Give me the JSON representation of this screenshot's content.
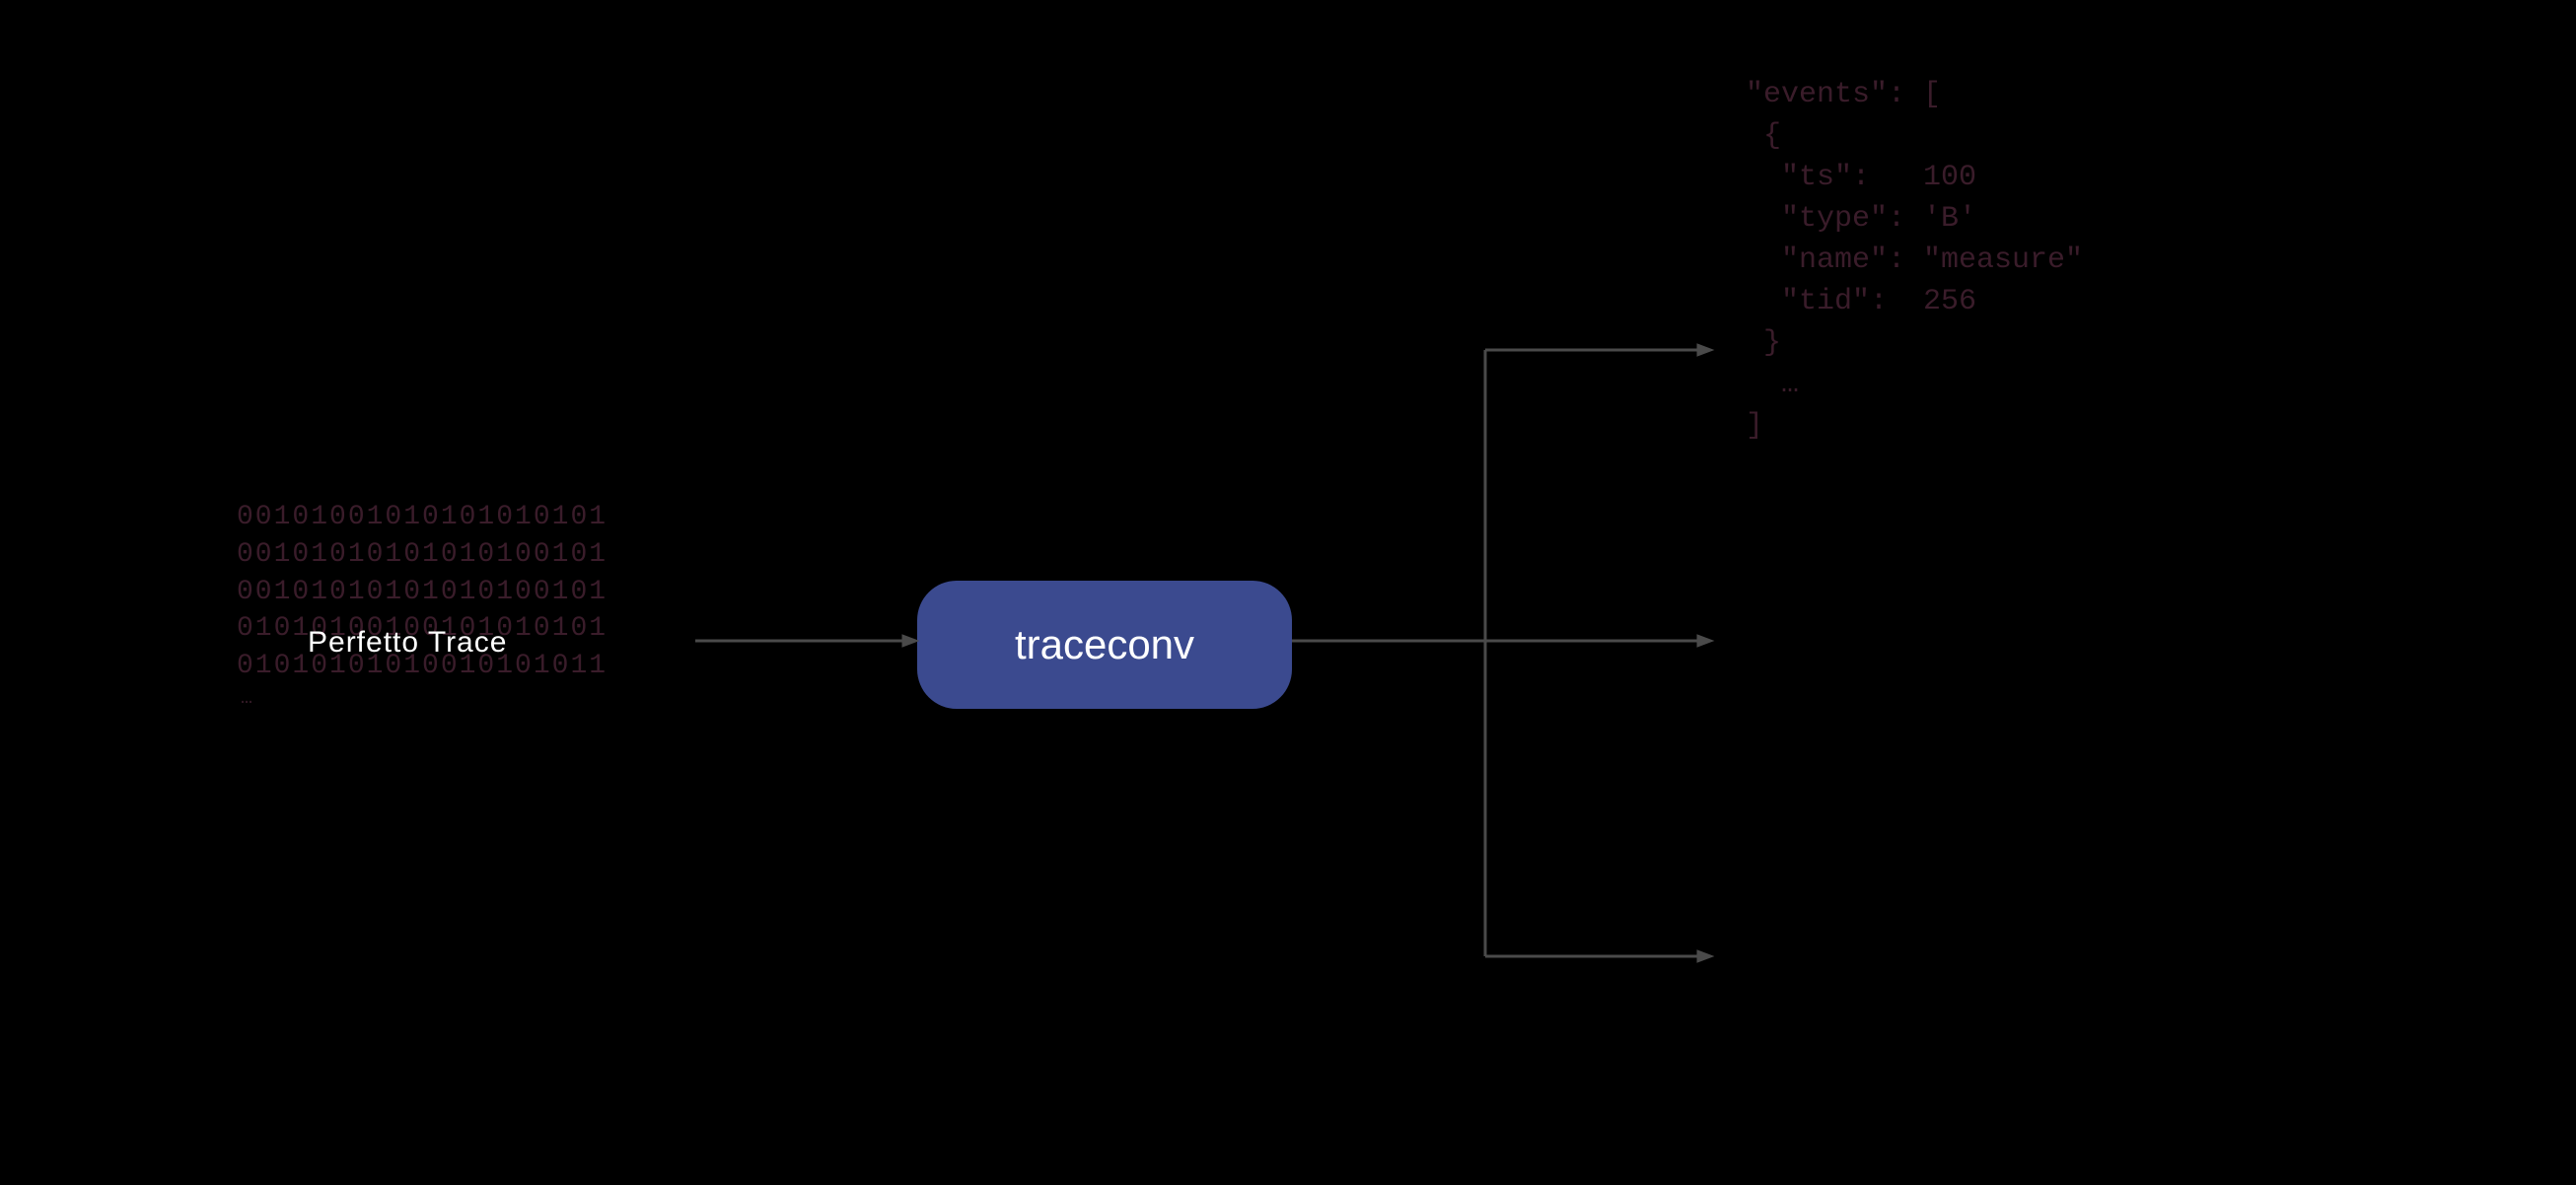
{
  "input": {
    "binary_lines": [
      "00101001010101010101",
      "00101010101010100101",
      "00101010101010100101",
      "01010100100101010101",
      "01010101010010101011"
    ],
    "ellipsis": "…",
    "label": "Perfetto  Trace"
  },
  "process": {
    "label": "traceconv"
  },
  "output": {
    "json_text": "\"events\": [\n {\n  \"ts\":   100\n  \"type\": 'B'\n  \"name\": \"measure\"\n  \"tid\":  256\n }\n  …\n]"
  }
}
